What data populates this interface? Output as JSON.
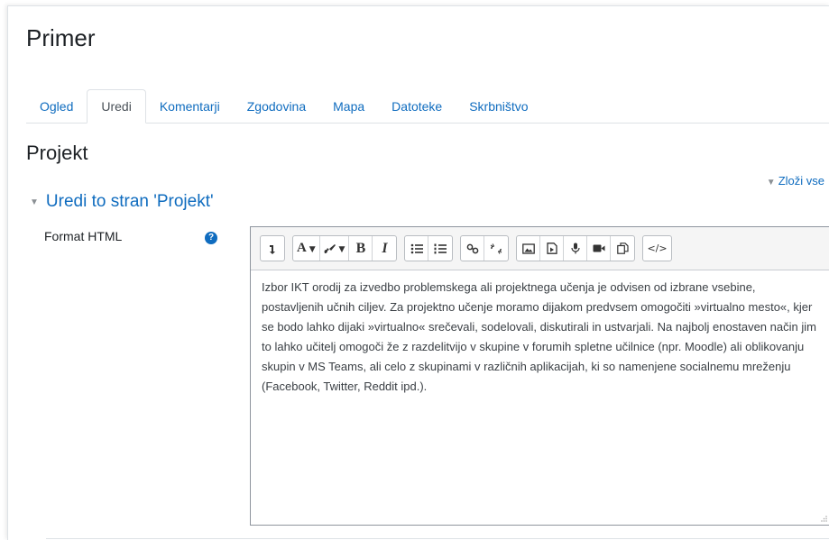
{
  "page": {
    "title": "Primer"
  },
  "tabs": [
    {
      "label": "Ogled"
    },
    {
      "label": "Uredi"
    },
    {
      "label": "Komentarji"
    },
    {
      "label": "Zgodovina"
    },
    {
      "label": "Mapa"
    },
    {
      "label": "Datoteke"
    },
    {
      "label": "Skrbništvo"
    }
  ],
  "active_tab": "Uredi",
  "section": {
    "title": "Projekt",
    "collapse_all": "Zloži vse"
  },
  "form": {
    "legend": "Uredi to stran 'Projekt'",
    "field_label": "Format HTML",
    "help_icon": "question-circle-icon"
  },
  "toolbar": {
    "buttons": [
      "toggle-toolbar-icon",
      "font-size-icon",
      "text-color-icon",
      "bold-icon",
      "italic-icon",
      "unordered-list-icon",
      "ordered-list-icon",
      "link-icon",
      "unlink-icon",
      "image-icon",
      "media-icon",
      "microphone-icon",
      "video-icon",
      "manage-files-icon",
      "html-source-icon"
    ],
    "bold_label": "B",
    "italic_label": "I",
    "font_label": "A"
  },
  "editor": {
    "content": "Izbor IKT orodij za izvedbo problemskega ali projektnega učenja je odvisen od izbrane vsebine, postavljenih učnih ciljev. Za projektno učenje moramo dijakom predvsem omogočiti »virtualno mesto«, kjer se bodo lahko dijaki »virtualno« srečevali, sodelovali, diskutirali in ustvarjali. Na najbolj enostaven način jim to lahko učitelj omogoči že z razdelitvijo v skupine v forumih spletne učilnice (npr. Moodle) ali oblikovanju skupin v MS Teams, ali celo z skupinami v različnih aplikacijah, ki so namenjene socialnemu mreženju (Facebook, Twitter, Reddit ipd.)."
  },
  "colors": {
    "link": "#0f6cbf",
    "text": "#1d2125",
    "border": "#dee2e6"
  }
}
